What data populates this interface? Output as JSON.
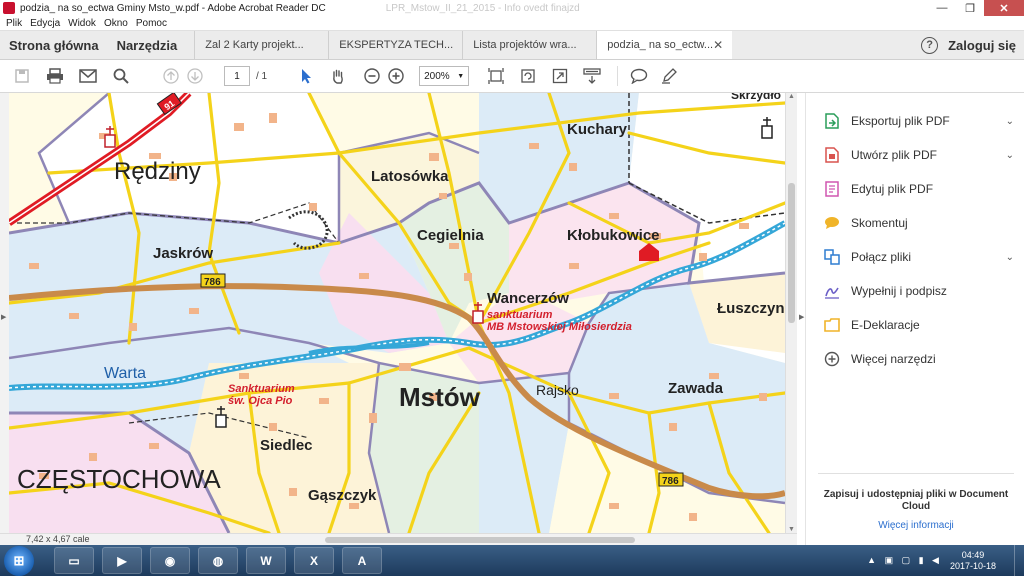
{
  "window": {
    "title": "podzia_ na so_ectwa Gminy Msto_w.pdf - Adobe Acrobat Reader DC",
    "background_ghost": "LPR_Mstow_II_21_2015 - Info ovedt finajzd",
    "min": "—",
    "max": "❐",
    "close": "✕"
  },
  "menu": [
    "Plik",
    "Edycja",
    "Widok",
    "Okno",
    "Pomoc"
  ],
  "tabs": {
    "home": "Strona główna",
    "tools": "Narzędzia",
    "docs": [
      {
        "label": "Zal 2 Karty projekt...",
        "active": false
      },
      {
        "label": "EKSPERTYZA TECH...",
        "active": false
      },
      {
        "label": "Lista projektów wra...",
        "active": false
      },
      {
        "label": "podzia_ na so_ectw...",
        "active": true
      }
    ],
    "close_glyph": "✕",
    "help": "?",
    "login": "Zaloguj się"
  },
  "toolbar": {
    "page_current": "1",
    "page_total": "/ 1",
    "zoom": "200%",
    "icons": [
      "save-icon",
      "print-icon",
      "email-icon",
      "search-icon",
      "prev-page-icon",
      "next-page-icon",
      "select-cursor-icon",
      "hand-icon",
      "zoom-out-icon",
      "zoom-in-icon",
      "zoom-dropdown-icon",
      "fit-width-icon",
      "rotate-icon",
      "fullscreen-icon",
      "read-mode-icon",
      "comment-icon",
      "pen-icon"
    ]
  },
  "map": {
    "labels": {
      "redziny": "Rędziny",
      "latosowka": "Latosówka",
      "kuchary": "Kuchary",
      "cegielnia": "Cegielnia",
      "klobukowice": "Kłobukowice",
      "jaskrow": "Jaskrów",
      "wancerzow": "Wancerzów",
      "luszczyn": "Łuszczyn",
      "warta": "Warta",
      "mstow": "Mstów",
      "rajsko": "Rajsko",
      "zawada": "Zawada",
      "siedlec": "Siedlec",
      "czestochowa": "CZĘSTOCHOWA",
      "gaszczyk": "Gąszczyk",
      "skrzydlow": "Skrzydło",
      "sanct1_line1": "sanktuarium",
      "sanct1_line2": "MB Mstowskiej Miłosierdzia",
      "sanct2_line1": "Sanktuarium",
      "sanct2_line2": "św. Ojca Pio",
      "road786a": "786",
      "road786b": "786",
      "road91": "91"
    }
  },
  "status": {
    "dims": "7,42 x 4,67 cale"
  },
  "panel": {
    "tools": [
      {
        "label": "Eksportuj plik PDF",
        "icon": "export-pdf-icon",
        "chevron": true,
        "color": "#2a9d5a"
      },
      {
        "label": "Utwórz plik PDF",
        "icon": "create-pdf-icon",
        "chevron": true,
        "color": "#d9534f"
      },
      {
        "label": "Edytuj plik PDF",
        "icon": "edit-pdf-icon",
        "chevron": false,
        "color": "#d056b0"
      },
      {
        "label": "Skomentuj",
        "icon": "comment-icon",
        "chevron": false,
        "color": "#f0b429"
      },
      {
        "label": "Połącz pliki",
        "icon": "combine-icon",
        "chevron": true,
        "color": "#2f7dd1"
      },
      {
        "label": "Wypełnij i podpisz",
        "icon": "sign-icon",
        "chevron": false,
        "color": "#6b5fc7"
      },
      {
        "label": "E-Deklaracje",
        "icon": "folder-icon",
        "chevron": false,
        "color": "#f0b429"
      },
      {
        "label": "Więcej narzędzi",
        "icon": "more-tools-icon",
        "chevron": false,
        "color": "#555555"
      }
    ],
    "promo": "Zapisuj i udostępniaj pliki w Document Cloud",
    "more": "Więcej informacji"
  },
  "taskbar": {
    "apps": [
      "explorer-icon",
      "media-player-icon",
      "chrome-icon",
      "firefox-icon",
      "word-icon",
      "excel-icon",
      "acrobat-icon"
    ],
    "app_glyphs": [
      "▭",
      "▶",
      "◉",
      "◍",
      "W",
      "X",
      "A"
    ],
    "start": "⊞",
    "tray": "▲ ▣ ▢ ▮ ◀",
    "time": "04:49",
    "date": "2017-10-18"
  },
  "colors": {
    "accent": "#2c6fce",
    "map_road_yellow": "#f4d31a",
    "map_road_orange": "#c98a4a",
    "map_road_red": "#e01b24",
    "river": "#35a7d8"
  }
}
